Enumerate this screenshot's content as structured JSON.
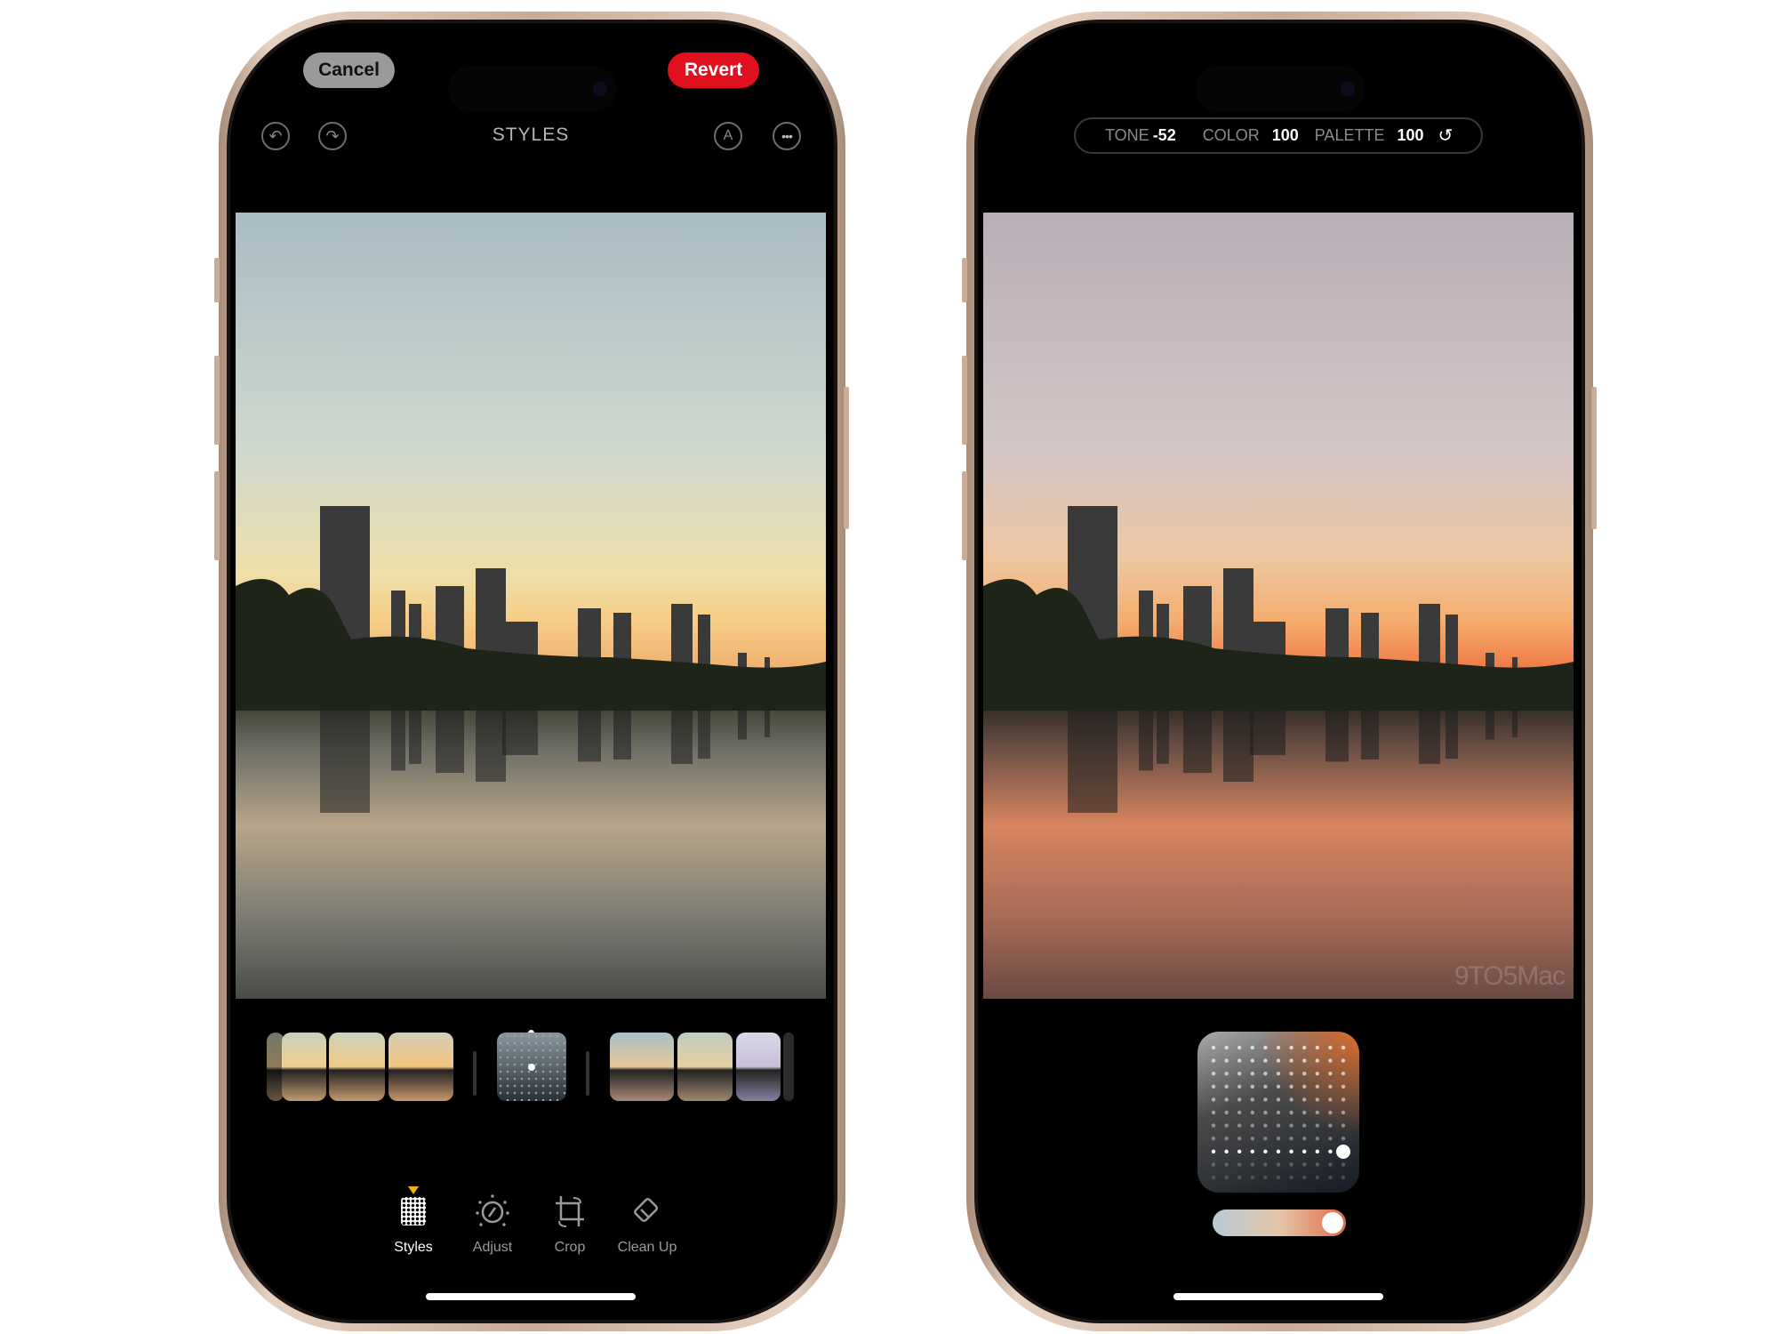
{
  "left_phone": {
    "header": {
      "cancel_label": "Cancel",
      "revert_label": "Revert",
      "title": "STYLES"
    },
    "header_icons": [
      "undo-icon",
      "redo-icon",
      "markup-icon",
      "more-icon"
    ],
    "thumbnails_left_count": 3,
    "thumbnails_right_count": 3,
    "toolbar": [
      {
        "label": "Styles",
        "icon": "styles-grid-icon",
        "active": true
      },
      {
        "label": "Adjust",
        "icon": "adjust-dial-icon",
        "active": false
      },
      {
        "label": "Crop",
        "icon": "crop-rotate-icon",
        "active": false
      },
      {
        "label": "Clean Up",
        "icon": "eraser-icon",
        "active": false
      }
    ],
    "colors": {
      "revert": "#e0101e",
      "cancel": "#9a9a9a",
      "active_indicator": "#f5b400"
    }
  },
  "right_phone": {
    "adjustments": {
      "tone_label": "TONE",
      "tone_value": "-52",
      "color_label": "COLOR",
      "color_value": "100",
      "palette_label": "PALETTE",
      "palette_value": "100"
    },
    "reset_icon": "reset-icon",
    "watermark": "9TO5Mac",
    "palette_slider_value": 100
  }
}
